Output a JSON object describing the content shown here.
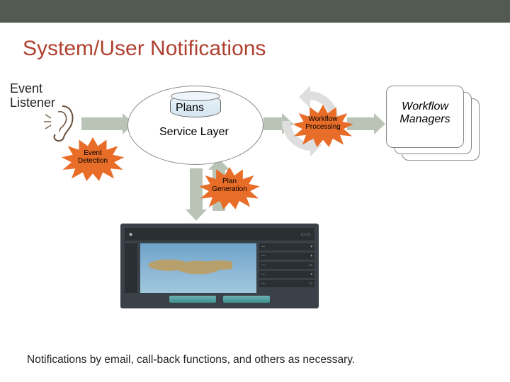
{
  "title": "System/User Notifications",
  "event_listener_label": "Event\nListener",
  "service_layer": {
    "plans_label": "Plans",
    "label": "Service Layer"
  },
  "workflow_managers_label": "Workflow\nManagers",
  "starbursts": {
    "event_detection": "Event\nDetection",
    "workflow_processing": "Workflow\nProcessing",
    "plan_generation": "Plan\nGeneration"
  },
  "footer": "Notifications by email, call-back functions, and others as necessary."
}
